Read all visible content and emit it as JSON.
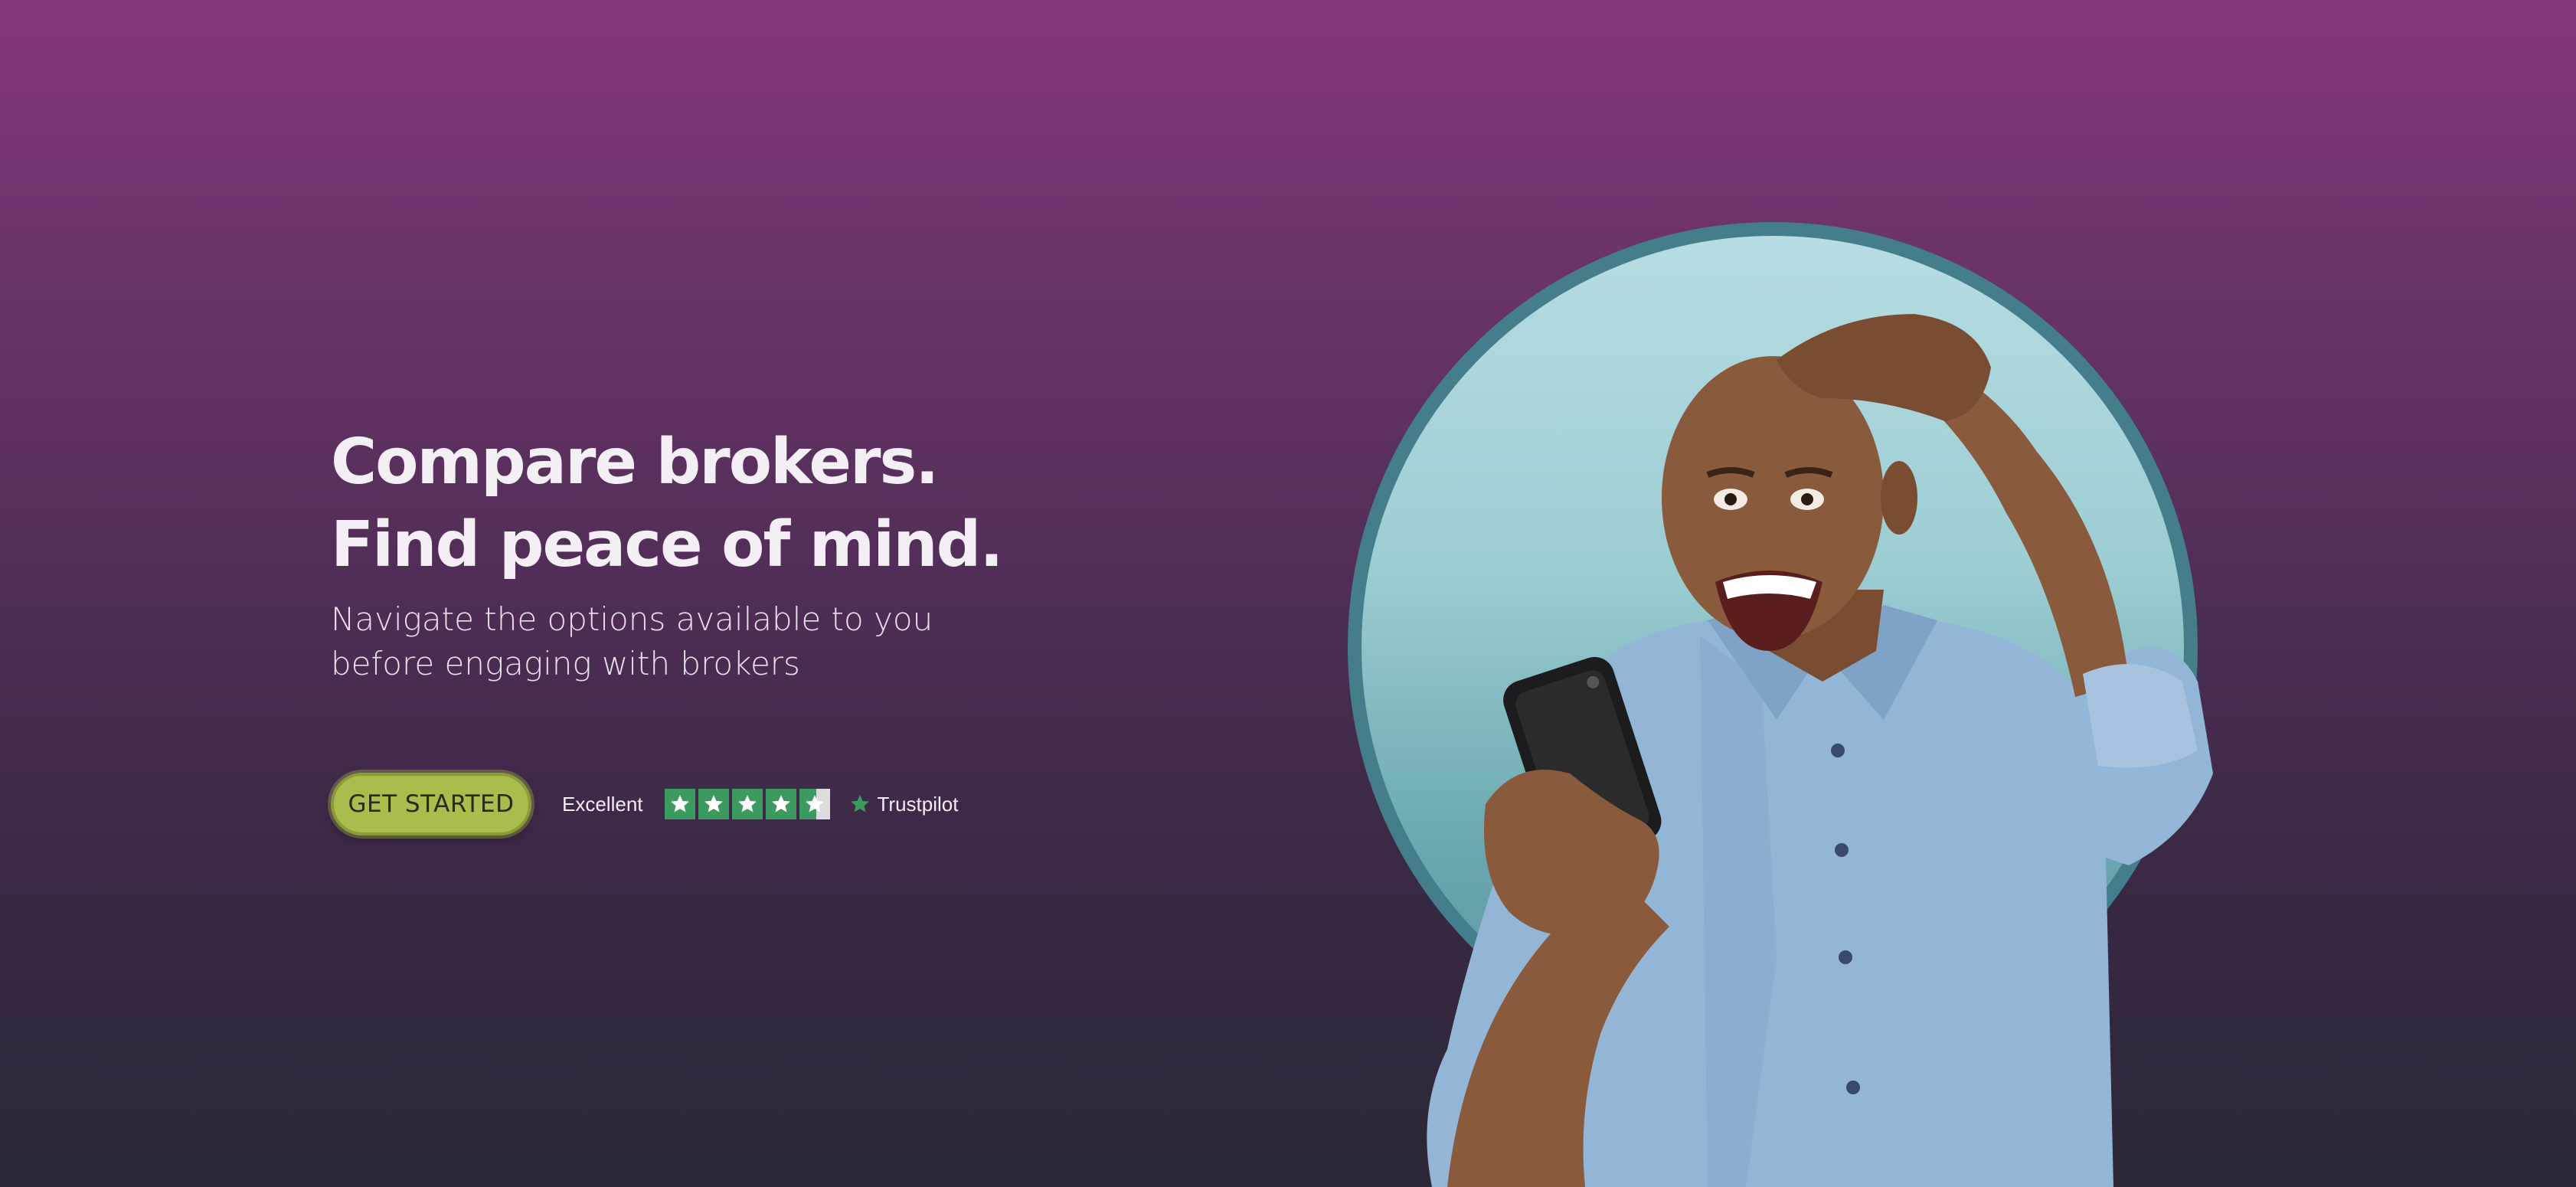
{
  "hero": {
    "headline_line1": "Compare brokers.",
    "headline_line2": "Find peace of mind.",
    "subhead": "Navigate the options available to you before engaging with brokers",
    "cta_label": "GET STARTED"
  },
  "rating": {
    "label": "Excellent",
    "stars_filled": 4.5,
    "stars_total": 5,
    "brand": "Trustpilot"
  },
  "icons": {
    "rating_star": "star-icon",
    "brand_star": "trustpilot-star-icon"
  },
  "colors": {
    "background_top": "#853779",
    "background_bottom": "#2b2736",
    "cta_background": "#a8bd4c",
    "star_green": "#3d9a5f",
    "circle_ring": "#447e8b",
    "circle_fill": "#9ccdd3",
    "shirt": "#94b6d6",
    "skin": "#8a5a3c"
  }
}
